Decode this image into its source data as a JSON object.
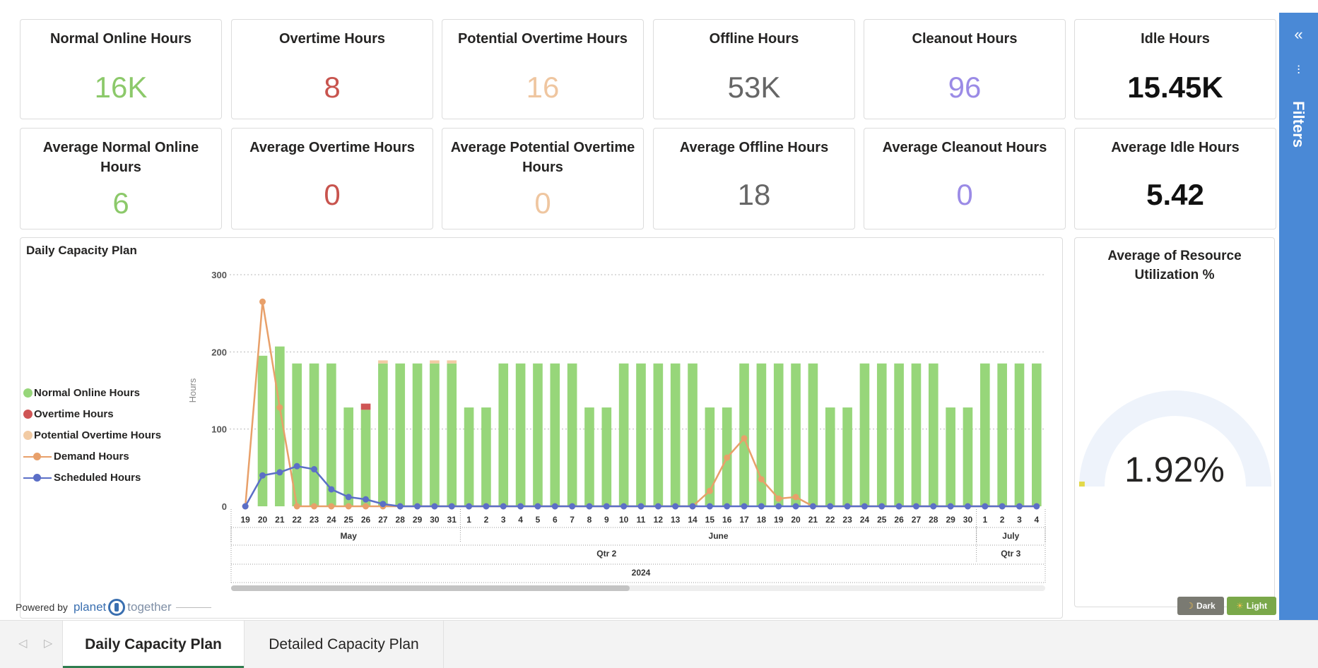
{
  "kpis_row1": [
    {
      "title": "Normal Online Hours",
      "value": "16K",
      "color": "#8cc96a"
    },
    {
      "title": "Overtime Hours",
      "value": "8",
      "color": "#c8544e"
    },
    {
      "title": "Potential Overtime Hours",
      "value": "16",
      "color": "#efc6a0"
    },
    {
      "title": "Offline Hours",
      "value": "53K",
      "color": "#666666"
    },
    {
      "title": "Cleanout Hours",
      "value": "96",
      "color": "#9b8be6"
    },
    {
      "title": "Idle Hours",
      "value": "15.45K",
      "color": "#111111"
    }
  ],
  "kpis_row2": [
    {
      "title": "Average Normal Online Hours",
      "value": "6",
      "color": "#8cc96a"
    },
    {
      "title": "Average Overtime Hours",
      "value": "0",
      "color": "#c8544e"
    },
    {
      "title": "Average Potential Overtime Hours",
      "value": "0",
      "color": "#efc6a0"
    },
    {
      "title": "Average Offline Hours",
      "value": "18",
      "color": "#666666"
    },
    {
      "title": "Average Cleanout Hours",
      "value": "0",
      "color": "#9b8be6"
    },
    {
      "title": "Average Idle Hours",
      "value": "5.42",
      "color": "#111111"
    }
  ],
  "chart_panel": {
    "title": "Daily Capacity Plan"
  },
  "chart_data": {
    "type": "bar",
    "title": "Daily Capacity Plan",
    "ylabel": "Hours",
    "ylim": [
      0,
      300
    ],
    "yticks": [
      0,
      100,
      200,
      300
    ],
    "grid": true,
    "legend_position": "left",
    "categories": [
      "19",
      "20",
      "21",
      "22",
      "23",
      "24",
      "25",
      "26",
      "27",
      "28",
      "29",
      "30",
      "31",
      "1",
      "2",
      "3",
      "4",
      "5",
      "6",
      "7",
      "8",
      "9",
      "10",
      "11",
      "12",
      "13",
      "14",
      "15",
      "16",
      "17",
      "18",
      "19",
      "20",
      "21",
      "22",
      "23",
      "24",
      "25",
      "26",
      "27",
      "28",
      "29",
      "30",
      "1",
      "2",
      "3",
      "4"
    ],
    "months": [
      {
        "label": "May",
        "count": 13
      },
      {
        "label": "June",
        "count": 30
      },
      {
        "label": "July",
        "count": 4
      }
    ],
    "quarters": [
      {
        "label": "Qtr 2",
        "count": 43
      },
      {
        "label": "Qtr 3",
        "count": 4
      }
    ],
    "years": [
      {
        "label": "2024",
        "count": 47
      }
    ],
    "series": [
      {
        "name": "Normal Online Hours",
        "kind": "bar",
        "color": "#97d67a",
        "values": [
          0,
          195,
          207,
          185,
          185,
          185,
          128,
          125,
          185,
          185,
          185,
          185,
          185,
          128,
          128,
          185,
          185,
          185,
          185,
          185,
          128,
          128,
          185,
          185,
          185,
          185,
          185,
          128,
          128,
          185,
          185,
          185,
          185,
          185,
          128,
          128,
          185,
          185,
          185,
          185,
          185,
          128,
          128,
          185,
          185,
          185,
          185
        ]
      },
      {
        "name": "Overtime Hours",
        "kind": "bar",
        "color": "#cf5555",
        "values": [
          0,
          0,
          0,
          0,
          0,
          0,
          0,
          8,
          0,
          0,
          0,
          0,
          0,
          0,
          0,
          0,
          0,
          0,
          0,
          0,
          0,
          0,
          0,
          0,
          0,
          0,
          0,
          0,
          0,
          0,
          0,
          0,
          0,
          0,
          0,
          0,
          0,
          0,
          0,
          0,
          0,
          0,
          0,
          0,
          0,
          0,
          0
        ]
      },
      {
        "name": "Potential Overtime Hours",
        "kind": "bar",
        "color": "#f2cba4",
        "values": [
          0,
          0,
          0,
          0,
          0,
          0,
          0,
          0,
          4,
          0,
          0,
          4,
          4,
          0,
          0,
          0,
          0,
          0,
          0,
          0,
          0,
          0,
          0,
          0,
          0,
          0,
          0,
          0,
          0,
          0,
          0,
          0,
          0,
          0,
          0,
          0,
          0,
          0,
          0,
          0,
          0,
          0,
          0,
          0,
          0,
          0,
          0
        ]
      },
      {
        "name": "Demand Hours",
        "kind": "line",
        "color": "#e8a06a",
        "values": [
          0,
          265,
          128,
          0,
          0,
          0,
          0,
          0,
          0,
          0,
          0,
          0,
          0,
          0,
          0,
          0,
          0,
          0,
          0,
          0,
          0,
          0,
          0,
          0,
          0,
          0,
          0,
          20,
          63,
          88,
          35,
          10,
          12,
          0,
          0,
          0,
          0,
          0,
          0,
          0,
          0,
          0,
          0,
          0,
          0,
          0,
          0
        ]
      },
      {
        "name": "Scheduled Hours",
        "kind": "line",
        "color": "#5b6fc7",
        "values": [
          0,
          40,
          44,
          52,
          48,
          22,
          12,
          9,
          3,
          0,
          0,
          0,
          0,
          0,
          0,
          0,
          0,
          0,
          0,
          0,
          0,
          0,
          0,
          0,
          0,
          0,
          0,
          0,
          0,
          0,
          0,
          0,
          0,
          0,
          0,
          0,
          0,
          0,
          0,
          0,
          0,
          0,
          0,
          0,
          0,
          0,
          0
        ]
      }
    ]
  },
  "powered_by": {
    "prefix": "Powered by",
    "brand_a": "planet",
    "brand_b": "together"
  },
  "gauge": {
    "title": "Average of Resource Utilization %",
    "value_label": "1.92%",
    "value": 1.92,
    "max": 100,
    "fill_color": "#e3d94a",
    "track_color": "#eef3fb"
  },
  "theme_toggle": {
    "dark_label": "Dark",
    "light_label": "Light"
  },
  "filters_pane": {
    "collapse_glyph": "«",
    "label": "Filters"
  },
  "tabs": [
    {
      "label": "Daily Capacity Plan",
      "active": true
    },
    {
      "label": "Detailed Capacity Plan",
      "active": false
    }
  ],
  "tab_nav": {
    "prev": "◁",
    "next": "▷"
  }
}
